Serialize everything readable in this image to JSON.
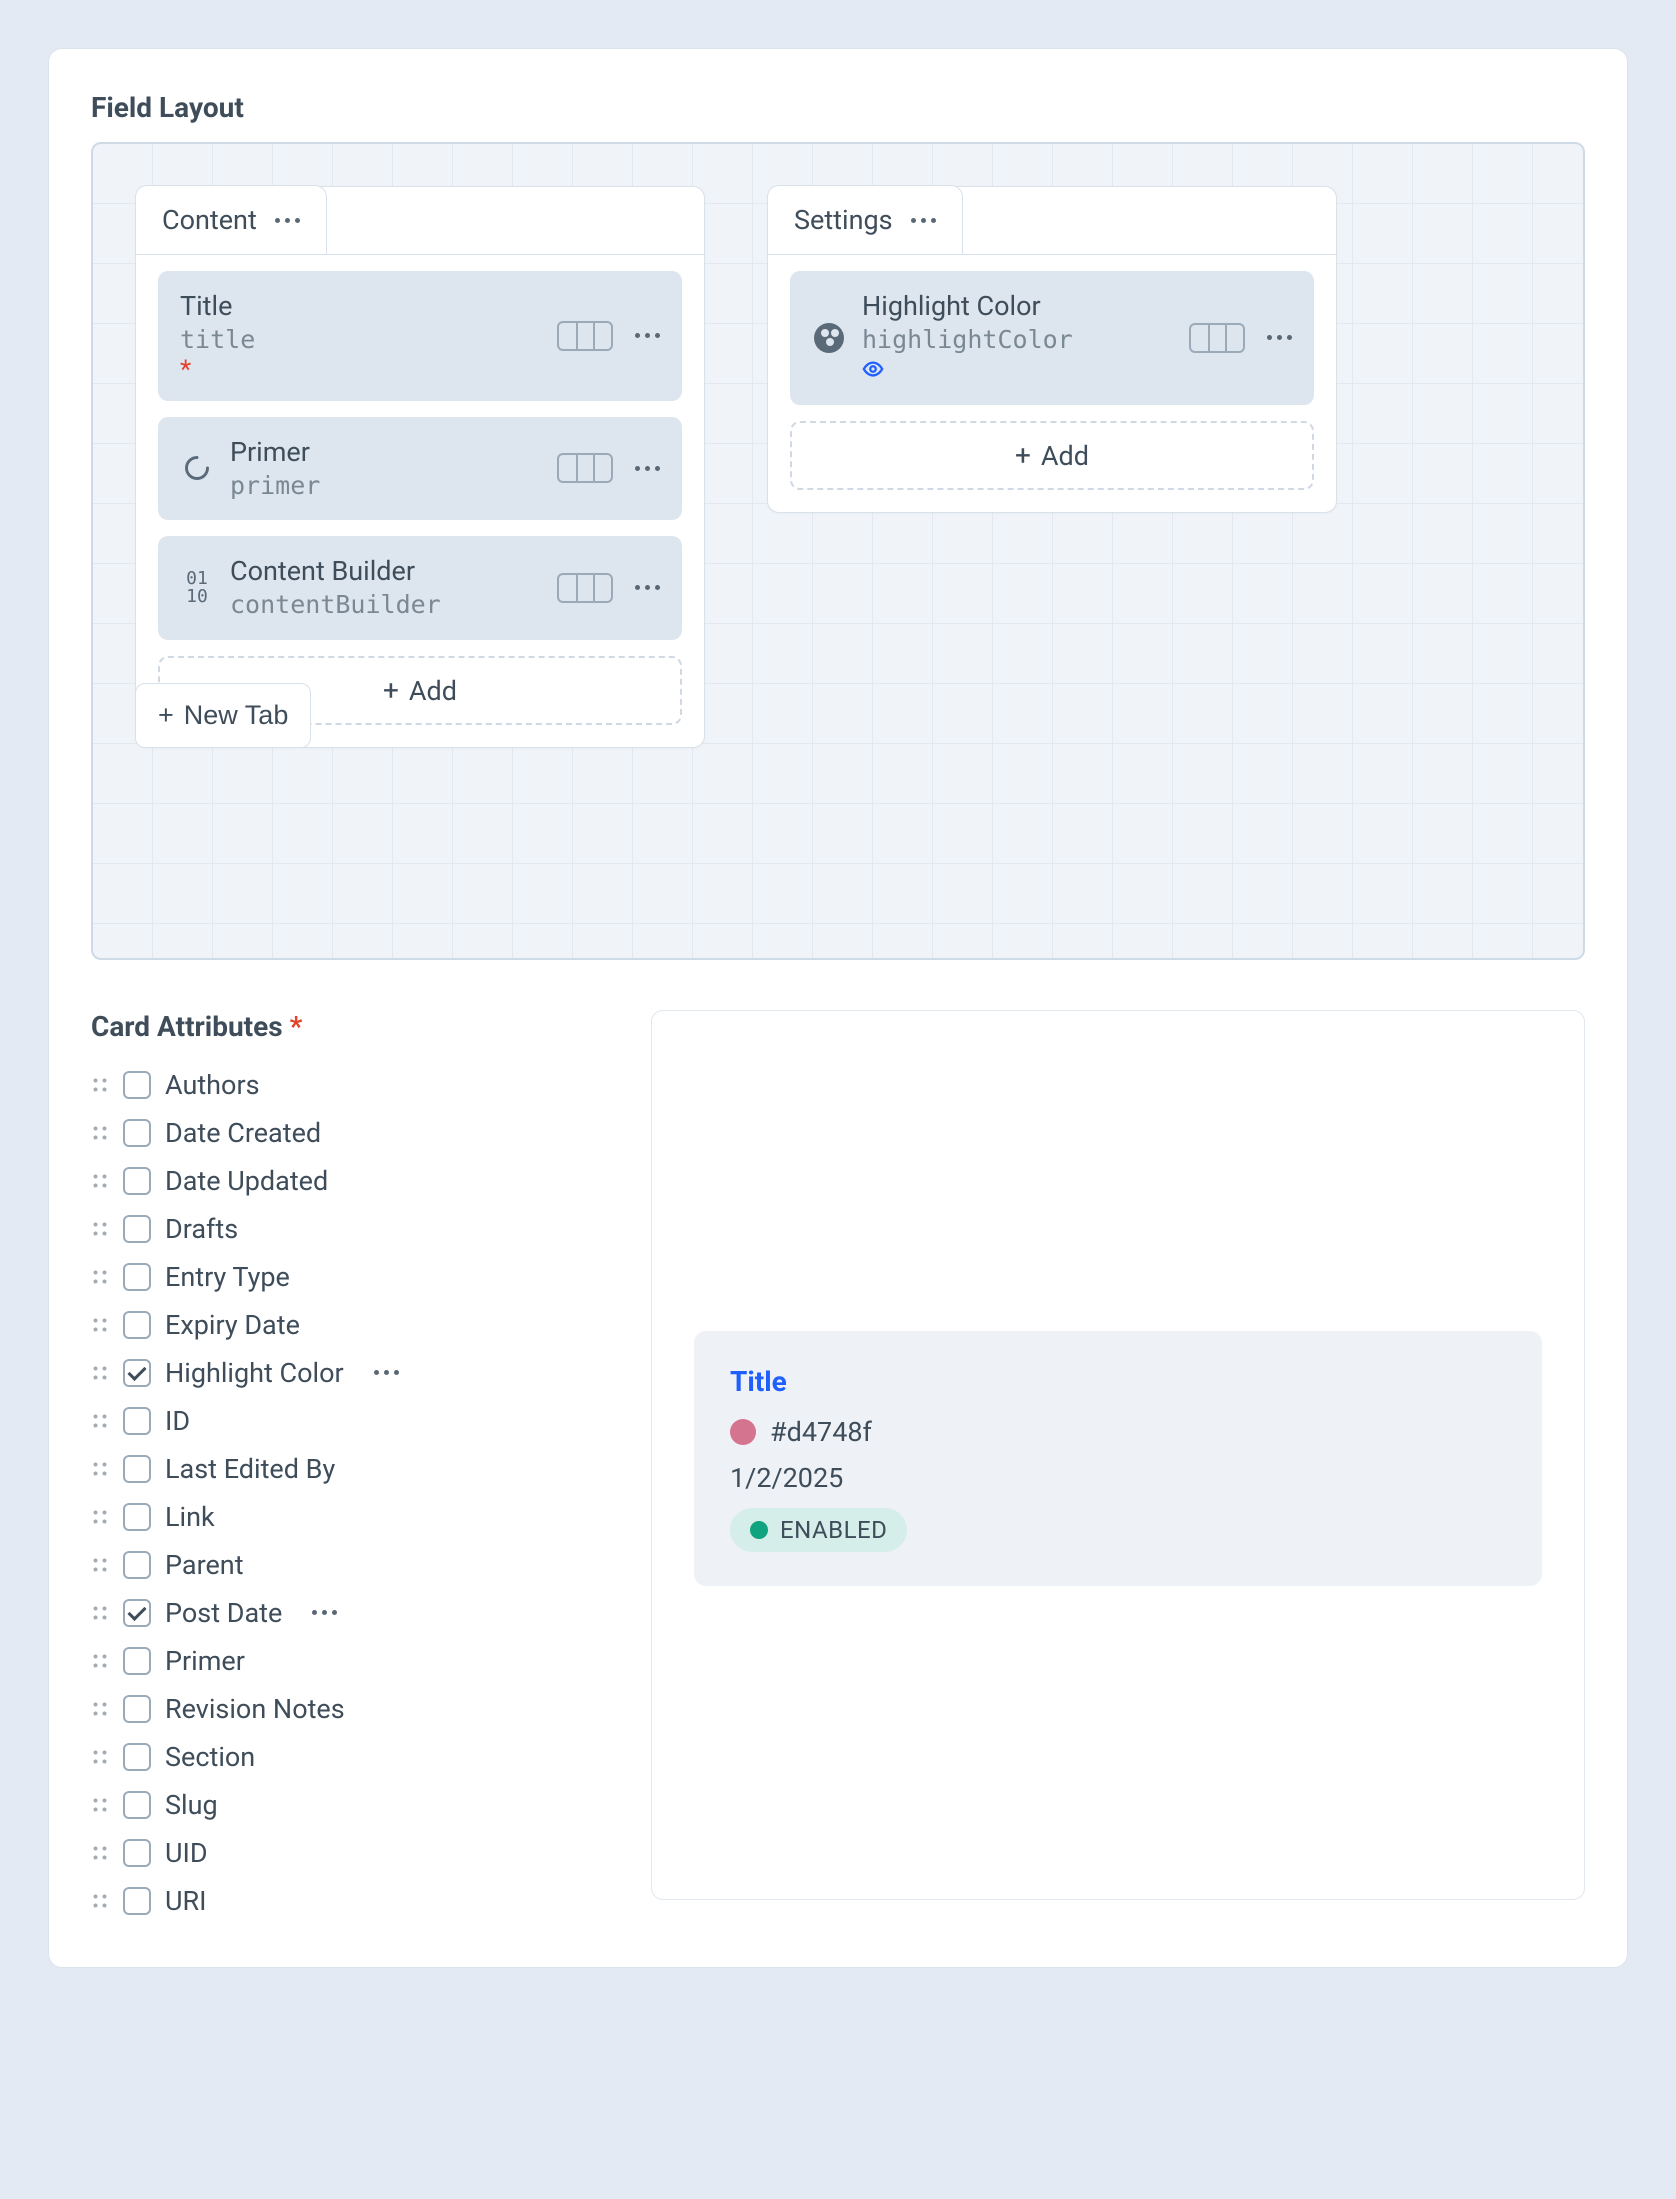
{
  "fieldLayout": {
    "title": "Field Layout",
    "tabs": [
      {
        "name": "Content",
        "fields": [
          {
            "label": "Title",
            "handle": "title",
            "required": true,
            "icon": "none"
          },
          {
            "label": "Primer",
            "handle": "primer",
            "required": false,
            "icon": "redactor"
          },
          {
            "label": "Content Builder",
            "handle": "contentBuilder",
            "required": false,
            "icon": "matrix"
          }
        ],
        "addLabel": "Add"
      },
      {
        "name": "Settings",
        "fields": [
          {
            "label": "Highlight Color",
            "handle": "highlightColor",
            "required": false,
            "icon": "palette",
            "visibility": true
          }
        ],
        "addLabel": "Add"
      }
    ],
    "newTabLabel": "New Tab"
  },
  "cardAttributes": {
    "title": "Card Attributes",
    "items": [
      {
        "label": "Authors",
        "checked": false
      },
      {
        "label": "Date Created",
        "checked": false
      },
      {
        "label": "Date Updated",
        "checked": false
      },
      {
        "label": "Drafts",
        "checked": false
      },
      {
        "label": "Entry Type",
        "checked": false
      },
      {
        "label": "Expiry Date",
        "checked": false
      },
      {
        "label": "Highlight Color",
        "checked": true,
        "hasActions": true
      },
      {
        "label": "ID",
        "checked": false
      },
      {
        "label": "Last Edited By",
        "checked": false
      },
      {
        "label": "Link",
        "checked": false
      },
      {
        "label": "Parent",
        "checked": false
      },
      {
        "label": "Post Date",
        "checked": true,
        "hasActions": true
      },
      {
        "label": "Primer",
        "checked": false
      },
      {
        "label": "Revision Notes",
        "checked": false
      },
      {
        "label": "Section",
        "checked": false
      },
      {
        "label": "Slug",
        "checked": false
      },
      {
        "label": "UID",
        "checked": false
      },
      {
        "label": "URI",
        "checked": false
      }
    ]
  },
  "cardPreview": {
    "title": "Title",
    "colorHex": "#d4748f",
    "date": "1/2/2025",
    "status": "ENABLED"
  }
}
